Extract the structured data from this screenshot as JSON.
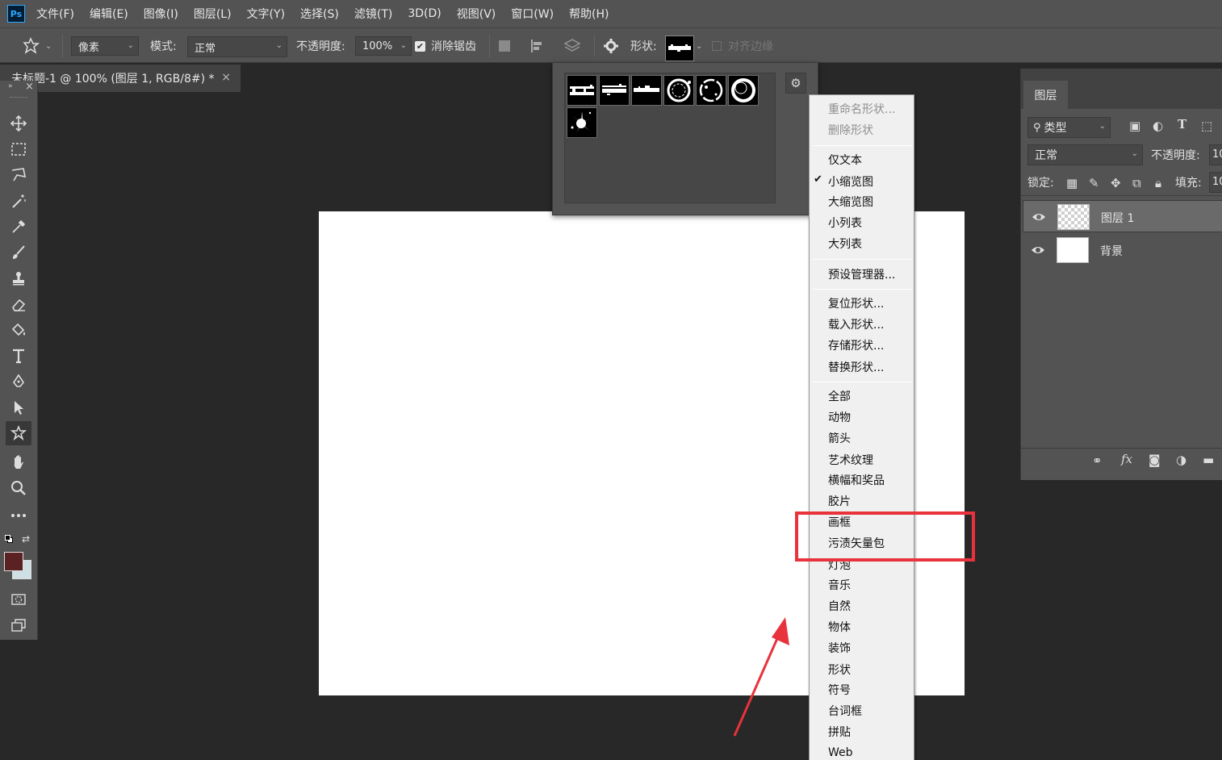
{
  "app": {
    "logo": "Ps"
  },
  "menubar": [
    "文件(F)",
    "编辑(E)",
    "图像(I)",
    "图层(L)",
    "文字(Y)",
    "选择(S)",
    "滤镜(T)",
    "3D(D)",
    "视图(V)",
    "窗口(W)",
    "帮助(H)"
  ],
  "options": {
    "pixel_select": "像素",
    "mode_label": "模式:",
    "mode_value": "正常",
    "opacity_label": "不透明度:",
    "opacity_value": "100%",
    "antialias_label": "消除锯齿",
    "antialias_checked": true,
    "shape_label": "形状:",
    "align_edges_label": "对齐边缘"
  },
  "document_tab": {
    "title": "未标题-1 @ 100% (图层 1, RGB/8#) *",
    "close": "×"
  },
  "toolbar": {
    "tools": [
      "move-tool",
      "marquee-tool",
      "lasso-tool",
      "magic-wand-tool",
      "eyedropper-tool",
      "brush-tool",
      "stamp-tool",
      "eraser-tool",
      "paint-bucket-tool",
      "type-tool",
      "pen-tool",
      "path-select-tool",
      "custom-shape-tool",
      "hand-tool",
      "zoom-tool",
      "more-tools"
    ],
    "active_tool": "custom-shape-tool",
    "foreground_color": "#5a2222",
    "background_color": "#cfe0e4"
  },
  "shape_menu": {
    "items": [
      {
        "label": "重命名形状...",
        "disabled": true
      },
      {
        "label": "删除形状",
        "disabled": true
      },
      {
        "separator": true
      },
      {
        "label": "仅文本"
      },
      {
        "label": "小缩览图",
        "checked": true
      },
      {
        "label": "大缩览图"
      },
      {
        "label": "小列表"
      },
      {
        "label": "大列表"
      },
      {
        "separator": true
      },
      {
        "label": "预设管理器..."
      },
      {
        "separator": true
      },
      {
        "label": "复位形状..."
      },
      {
        "label": "载入形状..."
      },
      {
        "label": "存储形状..."
      },
      {
        "label": "替换形状..."
      },
      {
        "separator": true
      },
      {
        "label": "全部"
      },
      {
        "label": "动物"
      },
      {
        "label": "箭头"
      },
      {
        "label": "艺术纹理"
      },
      {
        "label": "横幅和奖品"
      },
      {
        "label": "胶片"
      },
      {
        "label": "画框"
      },
      {
        "label": "污渍矢量包"
      },
      {
        "label": "灯泡"
      },
      {
        "label": "音乐"
      },
      {
        "label": "自然"
      },
      {
        "label": "物体"
      },
      {
        "label": "装饰"
      },
      {
        "label": "形状"
      },
      {
        "label": "符号"
      },
      {
        "label": "台词框"
      },
      {
        "label": "拼贴"
      },
      {
        "label": "Web"
      }
    ],
    "highlight_color": "#e8323c"
  },
  "layers_panel": {
    "tab": "图层",
    "filter_label": "类型",
    "blend_mode": "正常",
    "opacity_label": "不透明度:",
    "opacity_value": "10",
    "lock_label": "锁定:",
    "fill_label": "填充:",
    "fill_value": "10",
    "layers": [
      {
        "name": "图层 1",
        "selected": true,
        "transparent": true
      },
      {
        "name": "背景",
        "selected": false,
        "transparent": false
      }
    ]
  }
}
